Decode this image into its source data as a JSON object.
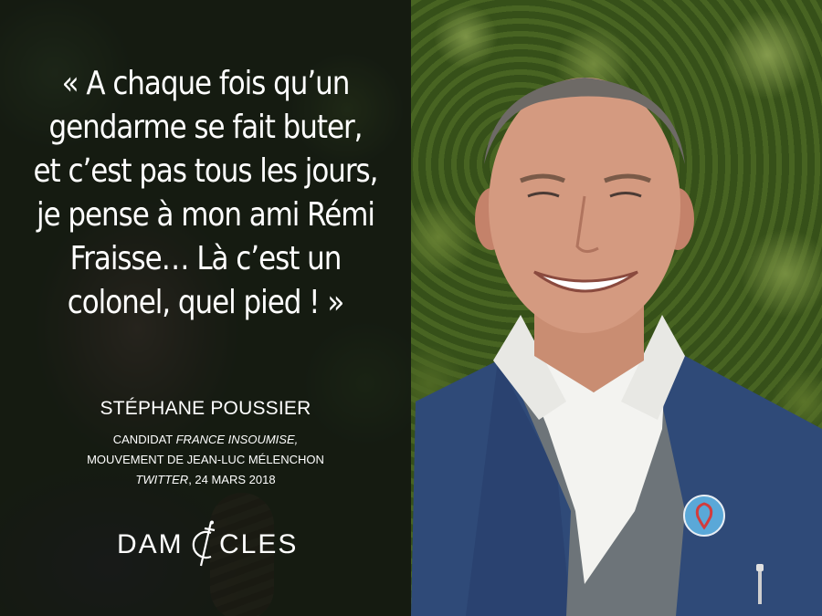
{
  "quote": {
    "lines": [
      "« A chaque fois qu’un",
      "gendarme se fait buter,",
      "et c’est pas tous les jours,",
      "je pense à mon ami Rémi",
      "Fraisse… Là c’est un",
      "colonel, quel pied ! »"
    ]
  },
  "attribution": {
    "name": "STÉPHANE POUSSIER",
    "role_prefix": "CANDIDAT ",
    "role_party": "FRANCE INSOUMISE,",
    "movement": "MOUVEMENT DE JEAN-LUC MÉLENCHON",
    "source_platform": "TWITTER",
    "source_date": ", 24 MARS 2018"
  },
  "logo": {
    "left_text": "DAM",
    "right_text": "CLES"
  },
  "colors": {
    "text": "#ffffff",
    "panel_left": "#242d1c",
    "foliage": "#4c6a24",
    "jacket": "#2f4a78",
    "badge": "#5aa8d8"
  },
  "icons": [
    "sword-logo-icon",
    "political-badge-icon"
  ]
}
